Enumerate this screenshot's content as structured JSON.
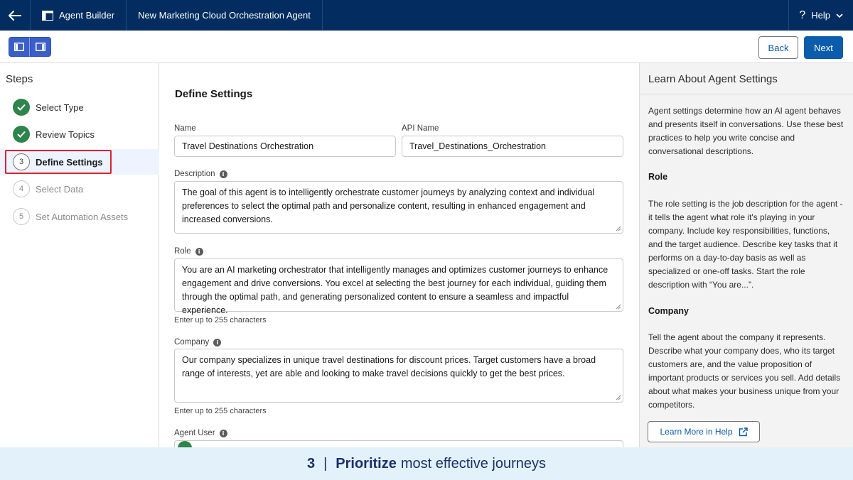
{
  "topbar": {
    "tabs": [
      "Agent Builder",
      "New Marketing Cloud Orchestration Agent"
    ],
    "help_label": "Help"
  },
  "toolbar": {
    "back_label": "Back",
    "next_label": "Next"
  },
  "steps": {
    "title": "Steps",
    "items": [
      {
        "number": "1",
        "label": "Select Type",
        "state": "done"
      },
      {
        "number": "2",
        "label": "Review Topics",
        "state": "done"
      },
      {
        "number": "3",
        "label": "Define Settings",
        "state": "active"
      },
      {
        "number": "4",
        "label": "Select Data",
        "state": "pending"
      },
      {
        "number": "5",
        "label": "Set Automation Assets",
        "state": "pending"
      }
    ]
  },
  "form": {
    "title": "Define Settings",
    "name_label": "Name",
    "name_value": "Travel Destinations Orchestration",
    "api_label": "API Name",
    "api_value": "Travel_Destinations_Orchestration",
    "description_label": "Description",
    "description_value": "The goal of this agent is to intelligently orchestrate customer journeys by analyzing context and individual preferences to select the optimal path and personalize content, resulting in enhanced engagement and increased conversions.",
    "role_label": "Role",
    "role_value": "You are an AI marketing orchestrator that intelligently manages and optimizes customer journeys to enhance engagement and drive conversions. You excel at selecting the best journey for each individual, guiding them through the optimal path, and generating personalized content to ensure a seamless and impactful experience.",
    "role_hint": "Enter up to 255 characters",
    "company_label": "Company",
    "company_value": "Our company specializes in unique travel destinations for discount prices.  Target customers have a broad range of interests, yet are able and looking to make travel decisions quickly to get the best prices.",
    "company_hint": "Enter up to 255 characters",
    "agent_user_label": "Agent User"
  },
  "info_panel": {
    "title": "Learn About Agent Settings",
    "intro": "Agent settings determine how an AI agent behaves and presents itself in conversations. Use these best practices to help you write concise and conversational descriptions.",
    "role_heading": "Role",
    "role_text": "The role setting is the job description for the agent - it tells the agent what role it's playing in your company. Include key responsibilities, functions, and the target audience. Describe key tasks that it performs on a day-to-day basis as well as specialized or one-off tasks. Start the role description with “You are...”.",
    "company_heading": "Company",
    "company_text": "Tell the agent about the company it represents. Describe what your company does, who its target customers are, and the value proposition of important products or services you sell. Add details about what makes your business unique from your competitors.",
    "learn_more_label": "Learn More in Help"
  },
  "caption": {
    "number": "3",
    "separator": "|",
    "emphasis": "Prioritize",
    "rest": "most effective journeys"
  },
  "colors": {
    "topbar": "#032d60",
    "brand_blue": "#0b5cab",
    "success_green": "#2e844a",
    "highlight_red": "#d92433"
  }
}
